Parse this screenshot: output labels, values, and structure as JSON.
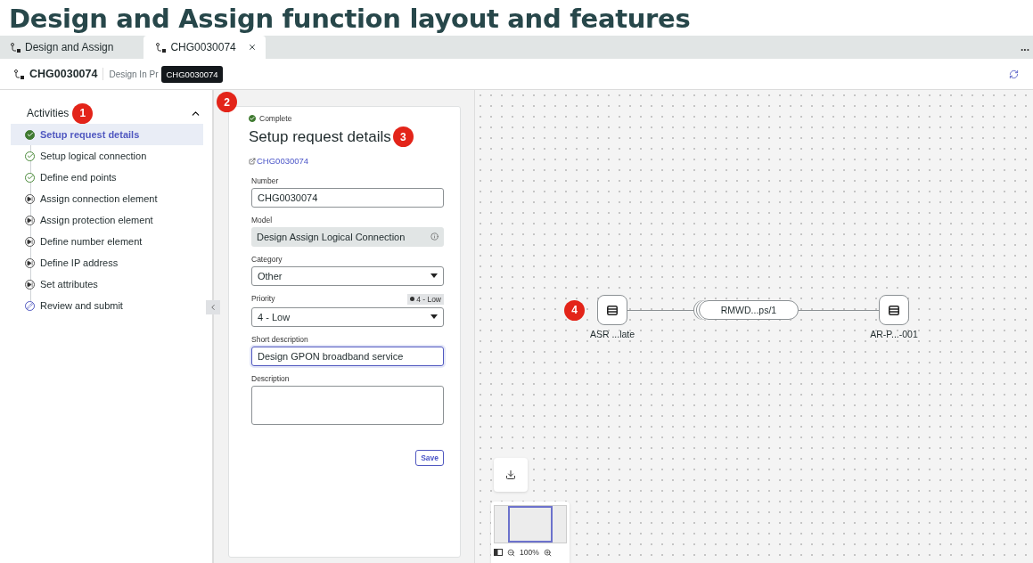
{
  "page_title": "Design and Assign function layout and features",
  "tabs": [
    {
      "label": "Design and Assign",
      "selected": false,
      "closable": false
    },
    {
      "label": "CHG0030074",
      "selected": true,
      "closable": true
    }
  ],
  "tab_overflow": "...",
  "header": {
    "record": "CHG0030074",
    "state": "Design In Pr",
    "tooltip": "CHG0030074"
  },
  "activities": {
    "title": "Activities",
    "badge": "1",
    "expanded": true,
    "items": [
      {
        "label": "Setup request details",
        "kind": "done",
        "selected": true
      },
      {
        "label": "Setup logical connection",
        "kind": "done",
        "selected": false
      },
      {
        "label": "Define end points",
        "kind": "done",
        "selected": false
      },
      {
        "label": "Assign connection element",
        "kind": "pending",
        "selected": false
      },
      {
        "label": "Assign protection element",
        "kind": "pending",
        "selected": false
      },
      {
        "label": "Define number element",
        "kind": "pending",
        "selected": false
      },
      {
        "label": "Define IP address",
        "kind": "pending",
        "selected": false
      },
      {
        "label": "Set attributes",
        "kind": "pending",
        "selected": false
      },
      {
        "label": "Review and submit",
        "kind": "review",
        "selected": false
      }
    ]
  },
  "form": {
    "badge": "2",
    "status": "Complete",
    "title": "Setup request details",
    "title_badge": "3",
    "link": "CHG0030074",
    "fields": [
      {
        "kind": "text",
        "label": "Number",
        "value": "CHG0030074",
        "focused": false
      },
      {
        "kind": "readonly",
        "label": "Model",
        "value": "Design Assign Logical Connection"
      },
      {
        "kind": "select",
        "label": "Category",
        "value": "Other"
      },
      {
        "kind": "select",
        "label": "Priority",
        "value": "4 - Low",
        "tag": "4 - Low"
      },
      {
        "kind": "text",
        "label": "Short description",
        "value": "Design GPON broadband service",
        "focused": true
      },
      {
        "kind": "textarea",
        "label": "Description"
      }
    ],
    "save": "Save"
  },
  "canvas": {
    "badge": "4",
    "nodes": [
      {
        "label": "ASR ...late"
      },
      {
        "label": "AR-P...-001"
      }
    ],
    "link": "RMWD...ps/1",
    "zoom": "100%"
  }
}
